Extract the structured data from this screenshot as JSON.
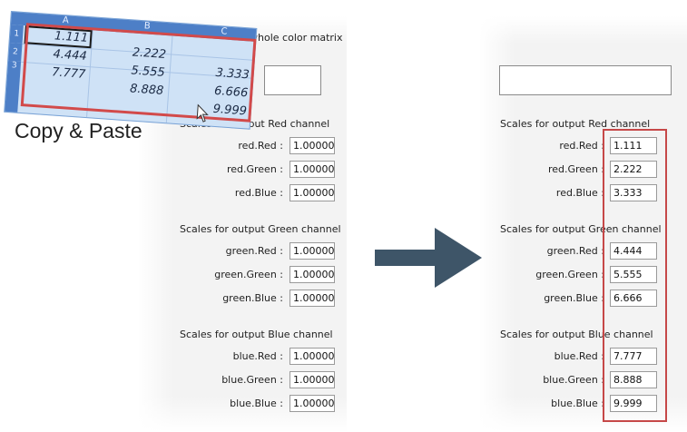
{
  "header_text": "Paste here the whole color matrix",
  "caption": "Copy & Paste",
  "spreadsheet": {
    "columns": [
      "A",
      "B",
      "C"
    ],
    "rows": [
      "1",
      "2",
      "3"
    ],
    "cells": [
      [
        "1.111",
        "2.222",
        "3.333"
      ],
      [
        "4.444",
        "5.555",
        "6.666"
      ],
      [
        "7.777",
        "8.888",
        "9.999"
      ]
    ]
  },
  "sections": [
    {
      "title": "Scales for output Red channel",
      "fields": [
        {
          "label": "red.Red :",
          "before": "1.00000",
          "after": "1.111"
        },
        {
          "label": "red.Green :",
          "before": "1.00000",
          "after": "2.222"
        },
        {
          "label": "red.Blue :",
          "before": "1.00000",
          "after": "3.333"
        }
      ]
    },
    {
      "title": "Scales for output Green channel",
      "fields": [
        {
          "label": "green.Red :",
          "before": "1.00000",
          "after": "4.444"
        },
        {
          "label": "green.Green :",
          "before": "1.00000",
          "after": "5.555"
        },
        {
          "label": "green.Blue :",
          "before": "1.00000",
          "after": "6.666"
        }
      ]
    },
    {
      "title": "Scales for output Blue channel",
      "fields": [
        {
          "label": "blue.Red :",
          "before": "1.00000",
          "after": "7.777"
        },
        {
          "label": "blue.Green :",
          "before": "1.00000",
          "after": "8.888"
        },
        {
          "label": "blue.Blue :",
          "before": "1.00000",
          "after": "9.999"
        }
      ]
    }
  ],
  "colors": {
    "arrow": "#3e5568",
    "highlight_border": "#c64848",
    "spreadsheet_bg": "#cfe2f6"
  },
  "icons": [
    "mouse-cursor-icon",
    "right-arrow-icon"
  ]
}
